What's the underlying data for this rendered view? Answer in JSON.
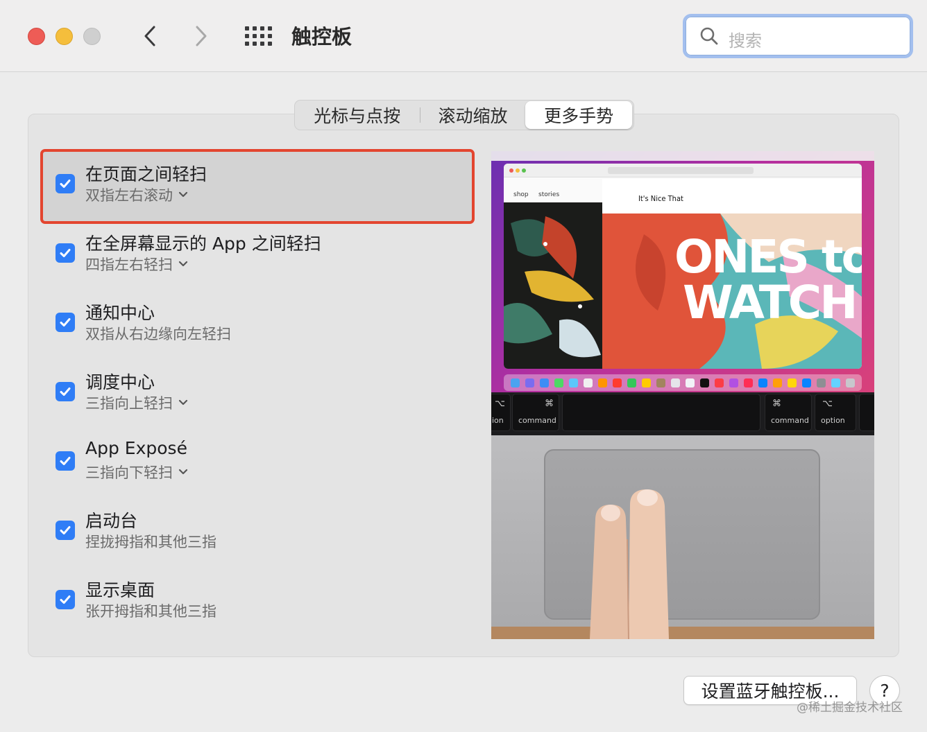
{
  "window": {
    "title": "触控板",
    "search_placeholder": "搜索"
  },
  "tabs": [
    {
      "label": "光标与点按",
      "selected": false
    },
    {
      "label": "滚动缩放",
      "selected": false
    },
    {
      "label": "更多手势",
      "selected": true
    }
  ],
  "gestures": [
    {
      "title": "在页面之间轻扫",
      "subtitle": "双指左右滚动",
      "checked": true,
      "has_menu": true,
      "highlighted": true
    },
    {
      "title": "在全屏幕显示的 App 之间轻扫",
      "subtitle": "四指左右轻扫",
      "checked": true,
      "has_menu": true
    },
    {
      "title": "通知中心",
      "subtitle": "双指从右边缘向左轻扫",
      "checked": true,
      "has_menu": false
    },
    {
      "title": "调度中心",
      "subtitle": "三指向上轻扫",
      "checked": true,
      "has_menu": true
    },
    {
      "title": "App Exposé",
      "subtitle": "三指向下轻扫",
      "checked": true,
      "has_menu": true
    },
    {
      "title": "启动台",
      "subtitle": "捏拢拇指和其他三指",
      "checked": true,
      "has_menu": false
    },
    {
      "title": "显示桌面",
      "subtitle": "张开拇指和其他三指",
      "checked": true,
      "has_menu": false
    }
  ],
  "preview": {
    "browser_tabs": [
      "shop",
      "stories"
    ],
    "site_logo": "It's Nice That",
    "headline_line1": "ONES to",
    "headline_line2": "WATCH",
    "keys": [
      {
        "symbol": "⌥",
        "label": "ion"
      },
      {
        "symbol": "⌘",
        "label": "command"
      },
      {
        "symbol": "⌘",
        "label": "command"
      },
      {
        "symbol": "⌥",
        "label": "option"
      }
    ]
  },
  "footer": {
    "bluetooth_button": "设置蓝牙触控板...",
    "help_button": "?",
    "watermark": "@稀土掘金技术社区"
  },
  "colors": {
    "accent": "#2f7df6",
    "highlight_border": "#e3452f",
    "close": "#ee5c56",
    "minimize": "#f5be3c",
    "zoom_disabled": "#cfcfcf"
  }
}
